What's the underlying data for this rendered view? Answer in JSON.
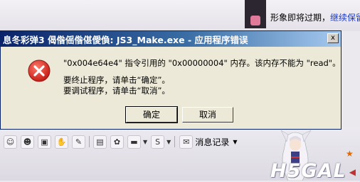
{
  "background": {
    "notice_text": "形象即将过期，",
    "notice_link": "继续保留",
    "toolbar": {
      "icons": [
        "smiley-icon",
        "emoji-icon",
        "photo-icon",
        "hand-icon",
        "brush-icon",
        "screenshot-icon",
        "gift-icon",
        "monitor-icon",
        "s-icon"
      ],
      "message_log_label": "消息记录"
    },
    "watermark": "H5GAL"
  },
  "dialog": {
    "title": "息冬彩弹3  偈偺傜偺偡僾偩: JS3_Make.exe - 应用程序错误",
    "message_line1": "\"0x004e64e4\" 指令引用的 \"0x00000004\" 内存。该内存不能为 \"read\"。",
    "message_line2": "要终止程序，请单击“确定”。",
    "message_line3": "要调试程序，请单击“取消”。",
    "ok_label": "确定",
    "cancel_label": "取消",
    "close_label": "x"
  },
  "colors": {
    "title_bar_start": "#0a246a",
    "title_bar_end": "#a6caf0",
    "error_red": "#d32f2f",
    "dialog_bg": "#ece9d8"
  }
}
